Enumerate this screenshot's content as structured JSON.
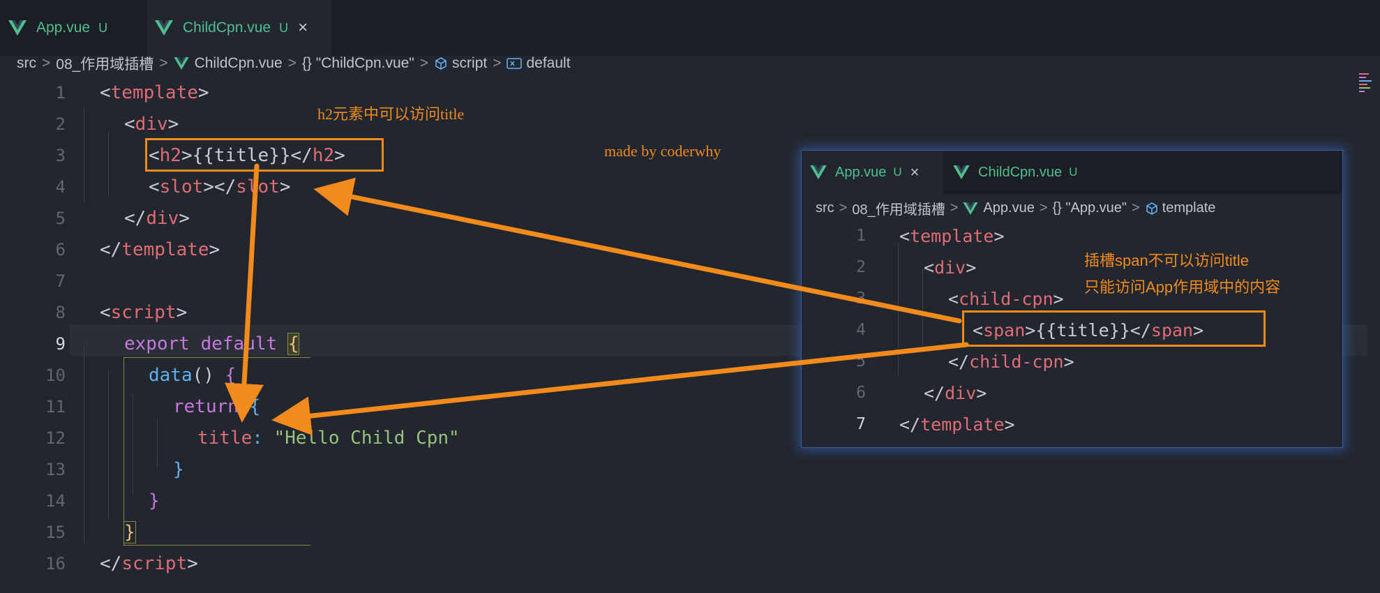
{
  "tabs": [
    {
      "name": "App.vue",
      "status": "U",
      "active": false
    },
    {
      "name": "ChildCpn.vue",
      "status": "U",
      "active": true,
      "close": "×"
    }
  ],
  "breadcrumb": {
    "src": "src",
    "folder": "08_作用域插槽",
    "file": "ChildCpn.vue",
    "obj": "{} \"ChildCpn.vue\"",
    "section": "script",
    "symbol": "default",
    "sep": ">"
  },
  "line_numbers": [
    "1",
    "2",
    "3",
    "4",
    "5",
    "6",
    "7",
    "8",
    "9",
    "10",
    "11",
    "12",
    "13",
    "14",
    "15",
    "16"
  ],
  "code": {
    "l1_open": "<",
    "l1_tag": "template",
    "l1_close": ">",
    "l2_open": "<",
    "l2_tag": "div",
    "l2_close": ">",
    "l3_a": "<",
    "l3_tag": "h2",
    "l3_b": ">{{title}}</",
    "l3_tag2": "h2",
    "l3_c": ">",
    "l4_a": "<",
    "l4_tag": "slot",
    "l4_b": "></",
    "l4_tag2": "slot",
    "l4_c": ">",
    "l5_a": "</",
    "l5_tag": "div",
    "l5_c": ">",
    "l6_a": "</",
    "l6_tag": "template",
    "l6_c": ">",
    "l8_a": "<",
    "l8_tag": "script",
    "l8_c": ">",
    "l9_kw1": "export",
    "l9_kw2": "default",
    "l9_brace": "{",
    "l10_fn": "data",
    "l10_paren": "()",
    "l10_brace": "{",
    "l11_kw": "return",
    "l11_brace": "{",
    "l12_prop": "title",
    "l12_colon": ":",
    "l12_str": "\"Hello Child Cpn\"",
    "l13": "}",
    "l14": "}",
    "l15": "}",
    "l16_a": "</",
    "l16_tag": "script",
    "l16_c": ">"
  },
  "annotations": {
    "h2_note": "h2元素中可以访问title",
    "watermark": "made by coderwhy",
    "span_note_1": "插槽span不可以访问title",
    "span_note_2": "只能访问App作用域中的内容"
  },
  "panel": {
    "tabs": [
      {
        "name": "App.vue",
        "status": "U",
        "active": true,
        "close": "×"
      },
      {
        "name": "ChildCpn.vue",
        "status": "U",
        "active": false
      }
    ],
    "breadcrumb": {
      "src": "src",
      "folder": "08_作用域插槽",
      "file": "App.vue",
      "obj": "{} \"App.vue\"",
      "section": "template",
      "sep": ">"
    },
    "line_numbers": [
      "1",
      "2",
      "3",
      "4",
      "5",
      "6",
      "7"
    ],
    "code": {
      "l1_a": "<",
      "l1_tag": "template",
      "l1_c": ">",
      "l2_a": "<",
      "l2_tag": "div",
      "l2_c": ">",
      "l3_a": "<",
      "l3_tag": "child-cpn",
      "l3_c": ">",
      "l4_a": "<",
      "l4_tag": "span",
      "l4_b": ">{{title}}</",
      "l4_tag2": "span",
      "l4_c": ">",
      "l5_a": "</",
      "l5_tag": "child-cpn",
      "l5_c": ">",
      "l6_a": "</",
      "l6_tag": "div",
      "l6_c": ">",
      "l7_a": "</",
      "l7_tag": "template",
      "l7_c": ">"
    }
  },
  "colors": {
    "accent_vue": "#4fc08d",
    "annotation": "#f28a1c",
    "tag": "#e06c75",
    "keyword": "#c678dd",
    "function": "#61afef",
    "string": "#98c379",
    "background": "#22262e"
  },
  "icons": [
    "vue-logo-icon",
    "close-icon",
    "chevron-right-icon",
    "braces-icon",
    "cube-icon",
    "variable-icon"
  ]
}
